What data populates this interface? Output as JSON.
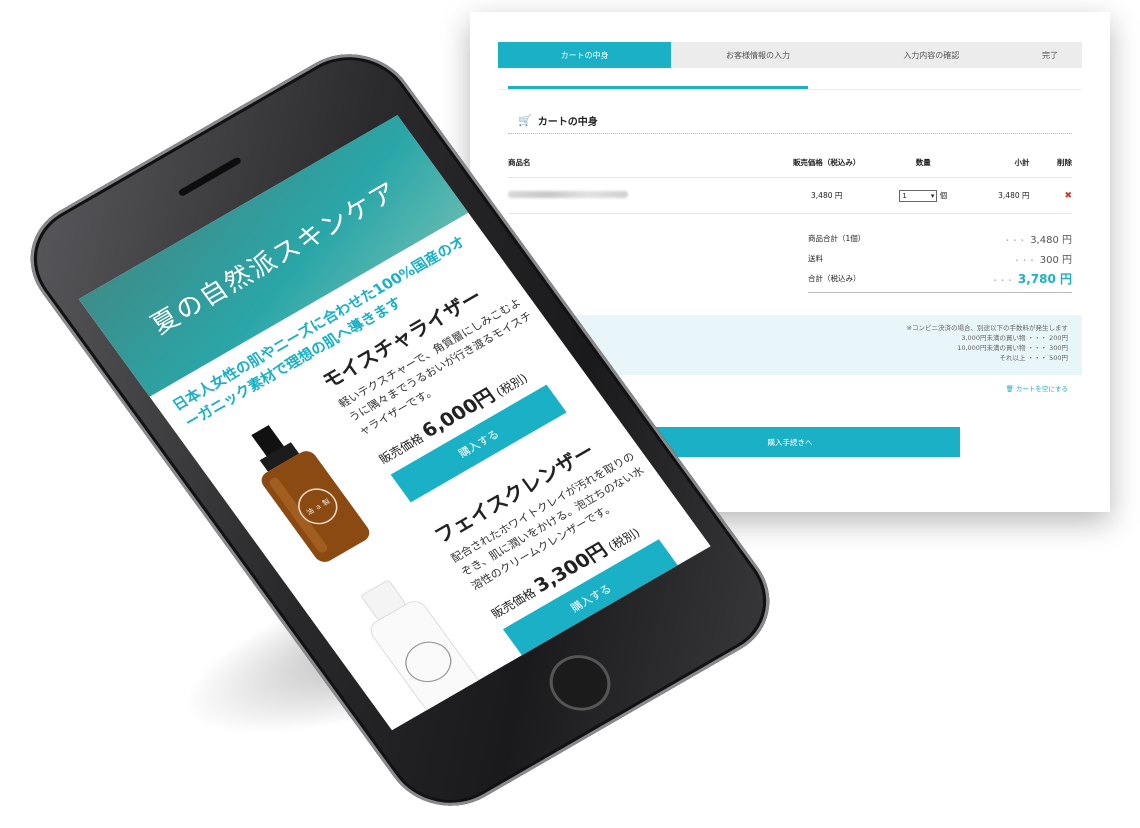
{
  "desktop": {
    "steps": [
      "カートの中身",
      "お客様情報の入力",
      "入力内容の確認",
      "完了"
    ],
    "cart_title": "カートの中身",
    "table": {
      "headers": [
        "商品名",
        "販売価格（税込み）",
        "数量",
        "小計",
        "削除"
      ],
      "row": {
        "price": "3,480 円",
        "qty": "1",
        "qty_unit": "個",
        "subtotal": "3,480 円",
        "delete": "✖"
      }
    },
    "totals": [
      {
        "label": "商品合計（1個）",
        "amount": "3,480 円"
      },
      {
        "label": "送料",
        "amount": "300 円"
      },
      {
        "label": "合計（税込み）",
        "amount": "3,780 円"
      }
    ],
    "notice": [
      "※コンビニ決済の場合、別途以下の手数料が発生します",
      "3,000円未満の買い物 ・・・ 200円",
      "10,000円未満の買い物 ・・・ 300円",
      "それ以上 ・・・ 500円"
    ],
    "empty_cart": "カートを空にする",
    "checkout": "購入手続きへ"
  },
  "phone": {
    "hero_title": "夏の自然派スキンケア",
    "tagline": "日本人女性の肌やニーズに合わせた100%国産のオーガニック素材で理想の肌へ導きます",
    "products": [
      {
        "title": "モイスチャライザー",
        "desc": "軽いテクスチャーで、角質層にしみこむように隅々までうるおいが行き渡るモイスチャライザーです。",
        "price_label": "販売価格",
        "price": "6,000円",
        "tax": "(税別)",
        "buy": "購入する"
      },
      {
        "title": "フェイスクレンザー",
        "desc": "配合されたホワイトクレイが汚れを取りのぞき、肌に潤いをかける。泡立ちのない水溶性のクリームクレンザーです。",
        "price_label": "販売価格",
        "price": "3,300円",
        "tax": "(税別)",
        "buy": "購入する"
      }
    ],
    "bottle_label": "油 ａ 製"
  }
}
